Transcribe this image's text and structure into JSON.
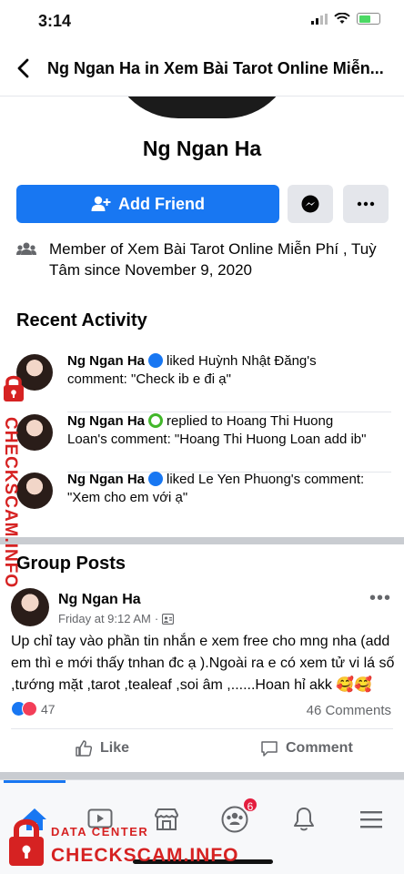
{
  "status_bar": {
    "time": "3:14"
  },
  "header": {
    "title": "Ng Ngan Ha in Xem Bài Tarot Online Miễn..."
  },
  "profile": {
    "name": "Ng Ngan Ha",
    "add_friend_label": "Add Friend",
    "member_prefix": "Member of ",
    "group_name": "Xem Bài Tarot Online Miễn Phí , Tuỳ Tâm",
    "member_suffix": " since November 9, 2020"
  },
  "recent_activity": {
    "title": "Recent Activity",
    "items": [
      {
        "name": "Ng Ngan Ha",
        "text_part1": "liked Huỳnh Nhật Đăng's",
        "text_part2": "comment: \"Check ib e đi ạ\"",
        "badge": "blue-badge"
      },
      {
        "name": "Ng Ngan Ha",
        "text_part1": "replied to Hoang Thi Huong",
        "text_part2": "Loan's comment: \"Hoang Thi Huong Loan add ib\"",
        "badge": "green-badge"
      },
      {
        "name": "Ng Ngan Ha",
        "text_part1": "liked Le Yen Phuong's comment:",
        "text_part2": "\"Xem cho em với ạ\"",
        "badge": "blue-badge"
      }
    ]
  },
  "group_posts": {
    "title": "Group Posts",
    "post": {
      "author": "Ng Ngan Ha",
      "time": "Friday at 9:12 AM",
      "separator": "·",
      "text": "Up chỉ tay vào phần tin nhắn e xem free cho mng nha (add em thì e mới thấy tnhan đc ạ ).Ngoài ra e có xem tử vi lá số ,tướng mặt ,tarot ,tealeaf ,soi âm ,......Hoan hỉ akk 🥰🥰",
      "reaction_count": "47",
      "comments_count": "46 Comments",
      "like_label": "Like",
      "comment_label": "Comment"
    }
  },
  "tabbar": {
    "notification_count": "6"
  },
  "watermark": {
    "side_text": "CHECKSCAM.INFO",
    "data_center": "DATA CENTER",
    "checkscam": "CHECKSCAM.INFO"
  },
  "colors": {
    "brand_blue": "#1877f2",
    "watermark_red": "#d62222",
    "badge_red": "#e41e3f"
  }
}
